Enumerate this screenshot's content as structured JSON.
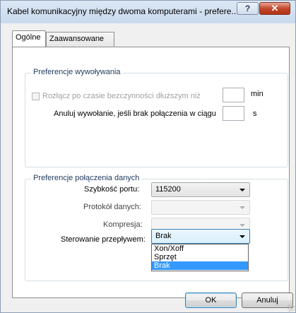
{
  "window": {
    "title": "Kabel komunikacyjny między dwoma komputerami - prefere...",
    "help_glyph": "?",
    "close_glyph": "✕"
  },
  "tabs": [
    {
      "label": "Ogólne",
      "active": true
    },
    {
      "label": "Zaawansowane",
      "active": false
    }
  ],
  "call_prefs": {
    "title": "Preferencje wywoływania",
    "disconnect_label": "Rozłącz po czasie bezczynności dłuższym niż",
    "disconnect_unit": "min",
    "disconnect_value": "",
    "cancel_label": "Anuluj wywołanie, jeśli brak połączenia w ciągu",
    "cancel_unit": "s",
    "cancel_value": ""
  },
  "data_prefs": {
    "title": "Preferencje połączenia danych",
    "port_speed_label": "Szybkość portu:",
    "port_speed_value": "115200",
    "protocol_label": "Protokół danych:",
    "protocol_value": "",
    "compression_label": "Kompresja:",
    "compression_value": "",
    "flow_label": "Sterowanie przepływem:",
    "flow_value": "Brak",
    "flow_options": [
      "Xon/Xoff",
      "Sprzęt",
      "Brak"
    ],
    "flow_selected_index": 2
  },
  "buttons": {
    "ok": "OK",
    "cancel": "Anuluj"
  },
  "colors": {
    "selection": "#3399ff",
    "group_title": "#1e395b"
  }
}
